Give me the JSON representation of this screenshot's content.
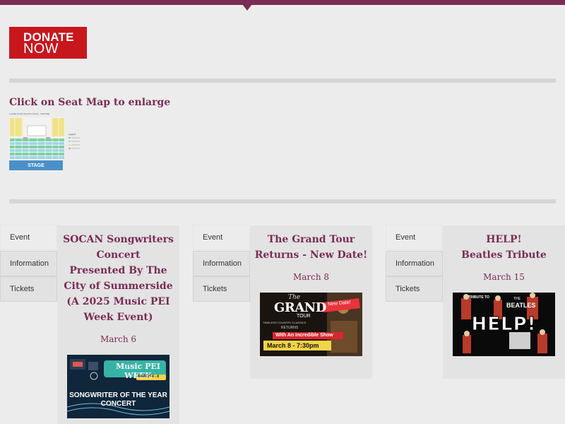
{
  "colors": {
    "brand": "#7a2c55",
    "donate_red": "#c8161d",
    "stage_blue": "#4a90c8"
  },
  "donate": {
    "line1": "DONATE",
    "line2": "NOW"
  },
  "seat_map": {
    "heading": "Click on Seat Map to enlarge",
    "map_title": "e Dollar Performing Arts Centre - Seat Map",
    "stage_label": "STAGE",
    "legend_label": "Legend"
  },
  "events": [
    {
      "tabs": [
        "Event",
        "Information",
        "Tickets"
      ],
      "title": "SOCAN Songwriters\nConcert\nPresented By The\nCity of Summerside\n(A 2025 Music PEI\nWeek Event)",
      "date": "March 6",
      "poster": {
        "brand": "Music PEI WEEK",
        "dates": "MARCH 4 - 8",
        "headline": "SONGWRITER OF THE YEAR",
        "subline": "CONCERT"
      }
    },
    {
      "tabs": [
        "Event",
        "Information",
        "Tickets"
      ],
      "title": "The Grand Tour\nReturns - New Date!",
      "date": "March 8",
      "poster": {
        "kicker": "The",
        "brand": "GRAND",
        "brand2": "TOUR",
        "tagline": "TIMELESS COUNTRY CLASSICS",
        "returns": "RETURNS",
        "badge": "New Date!",
        "show": "With An Incredible Show",
        "time": "March 8 - 7:30pm"
      }
    },
    {
      "tabs": [
        "Event",
        "Information",
        "Tickets"
      ],
      "title": "HELP!\nBeatles Tribute",
      "date": "March 15",
      "poster": {
        "kicker": "TRIBUTE TO",
        "kicker2": "THE",
        "band": "BEATLES",
        "headline": "HELP!"
      }
    }
  ]
}
